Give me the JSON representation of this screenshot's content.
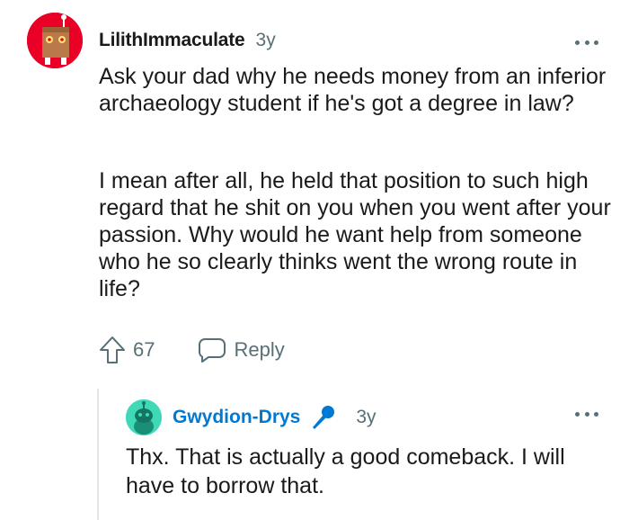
{
  "comment": {
    "username": "LilithImmaculate",
    "age": "3y",
    "paragraphs": [
      "Ask your dad why he needs money from an inferior archaeology student if he's got a degree in law?",
      "I mean after all, he held that position to such high regard that he shit on you when you went after your passion. Why would he want help from someone who he so clearly thinks went the wrong route in life?"
    ],
    "votes": "67",
    "reply_label": "Reply",
    "avatar_icon": "snoo-box-avatar",
    "colors": {
      "avatar_bg": "#ea0027",
      "meta": "#576f76"
    }
  },
  "reply": {
    "username": "Gwydion-Drys",
    "age": "3y",
    "text": "Thx. That is actually a good comeback. I will have to borrow that.",
    "flair_icon": "microphone-icon",
    "avatar_icon": "snoo-avatar",
    "colors": {
      "username": "#0079d3",
      "avatar_bg": "#3fd9b8"
    }
  }
}
